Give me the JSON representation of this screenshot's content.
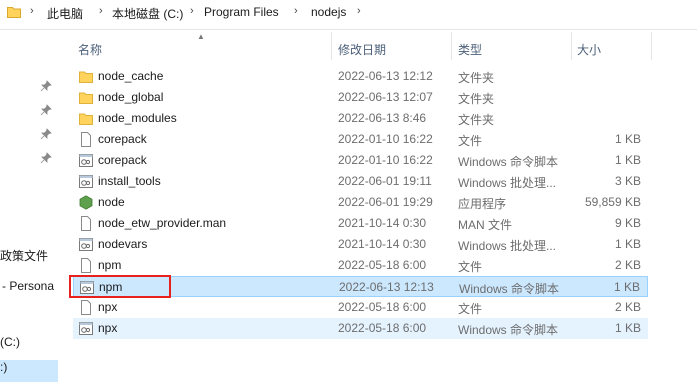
{
  "breadcrumb": [
    "此电脑",
    "本地磁盘 (C:)",
    "Program Files",
    "nodejs"
  ],
  "nav": {
    "items": [
      "政策文件",
      "- Persona",
      "(C:)",
      ":)"
    ]
  },
  "columns": {
    "name": "名称",
    "date": "修改日期",
    "type": "类型",
    "size": "大小"
  },
  "files": [
    {
      "name": "node_cache",
      "date": "2022-06-13 12:12",
      "type": "文件夹",
      "size": "",
      "icon": "folder-icon"
    },
    {
      "name": "node_global",
      "date": "2022-06-13 12:07",
      "type": "文件夹",
      "size": "",
      "icon": "folder-icon"
    },
    {
      "name": "node_modules",
      "date": "2022-06-13 8:46",
      "type": "文件夹",
      "size": "",
      "icon": "folder-icon"
    },
    {
      "name": "corepack",
      "date": "2022-01-10 16:22",
      "type": "文件",
      "size": "1 KB",
      "icon": "file-icon"
    },
    {
      "name": "corepack",
      "date": "2022-01-10 16:22",
      "type": "Windows 命令脚本",
      "size": "1 KB",
      "icon": "script-icon"
    },
    {
      "name": "install_tools",
      "date": "2022-06-01 19:11",
      "type": "Windows 批处理...",
      "size": "3 KB",
      "icon": "script-icon"
    },
    {
      "name": "node",
      "date": "2022-06-01 19:29",
      "type": "应用程序",
      "size": "59,859 KB",
      "icon": "node-icon"
    },
    {
      "name": "node_etw_provider.man",
      "date": "2021-10-14 0:30",
      "type": "MAN 文件",
      "size": "9 KB",
      "icon": "file-icon"
    },
    {
      "name": "nodevars",
      "date": "2021-10-14 0:30",
      "type": "Windows 批处理...",
      "size": "1 KB",
      "icon": "script-icon"
    },
    {
      "name": "npm",
      "date": "2022-05-18 6:00",
      "type": "文件",
      "size": "2 KB",
      "icon": "file-icon"
    },
    {
      "name": "npm",
      "date": "2022-06-13 12:13",
      "type": "Windows 命令脚本",
      "size": "1 KB",
      "icon": "script-icon"
    },
    {
      "name": "npx",
      "date": "2022-05-18 6:00",
      "type": "文件",
      "size": "2 KB",
      "icon": "file-icon"
    },
    {
      "name": "npx",
      "date": "2022-05-18 6:00",
      "type": "Windows 命令脚本",
      "size": "1 KB",
      "icon": "script-icon"
    }
  ],
  "colors": {
    "selected_bg": "#cce8ff",
    "hover_bg": "#e5f3ff",
    "highlight_border": "#e8211f",
    "folder": "#ffd35c"
  }
}
